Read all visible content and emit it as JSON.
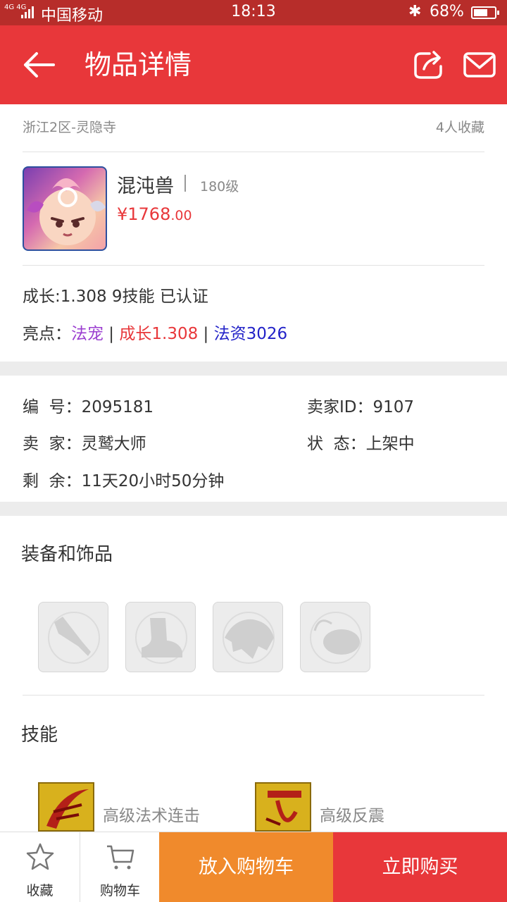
{
  "status_bar": {
    "network": "4G 4G",
    "carrier": "中国移动",
    "time": "18:13",
    "battery_text": "68%",
    "battery_level": 0.68
  },
  "header": {
    "title": "物品详情",
    "back_icon": "back-arrow-icon",
    "share_icon": "share-icon",
    "mail_icon": "mail-icon"
  },
  "item": {
    "location": "浙江2区-灵隐寺",
    "favorites": "4人收藏",
    "name": "混沌兽",
    "level": "180级",
    "price_main": "¥1768",
    "price_decimal": ".00",
    "growth_line": "成长:1.308 9技能 已认证",
    "highlights_label": "亮点：",
    "highlights": [
      {
        "text": "法宠",
        "color": "#9b3ed0"
      },
      {
        "text": "成长1.308",
        "color": "#e8373a"
      },
      {
        "text": "法资3026",
        "color": "#2323c8"
      }
    ],
    "highlight_separator": " | "
  },
  "details": {
    "id_label": "编  号：",
    "id_value": "2095181",
    "seller_id_label": "卖家ID：",
    "seller_id_value": "9107",
    "seller_label": "卖  家：",
    "seller_value": "灵鹫大师",
    "status_label": "状  态：",
    "status_value": "上架中",
    "remain_label": "剩  余：",
    "remain_value": "11天20小时50分钟"
  },
  "equipment": {
    "title": "装备和饰品",
    "slots": [
      "weapon-icon",
      "boot-icon",
      "armor-icon",
      "accessory-icon"
    ]
  },
  "skills": {
    "title": "技能",
    "items": [
      {
        "label": "高级法术连击",
        "icon": "skill-icon"
      },
      {
        "label": "高级反震",
        "icon": "skill-icon"
      }
    ]
  },
  "bottom_bar": {
    "favorite_label": "收藏",
    "cart_label": "购物车",
    "add_to_cart": "放入购物车",
    "buy_now": "立即购买"
  },
  "colors": {
    "primary": "#e8373a",
    "status_bar": "#b72d2a",
    "orange": "#f08a2c"
  }
}
